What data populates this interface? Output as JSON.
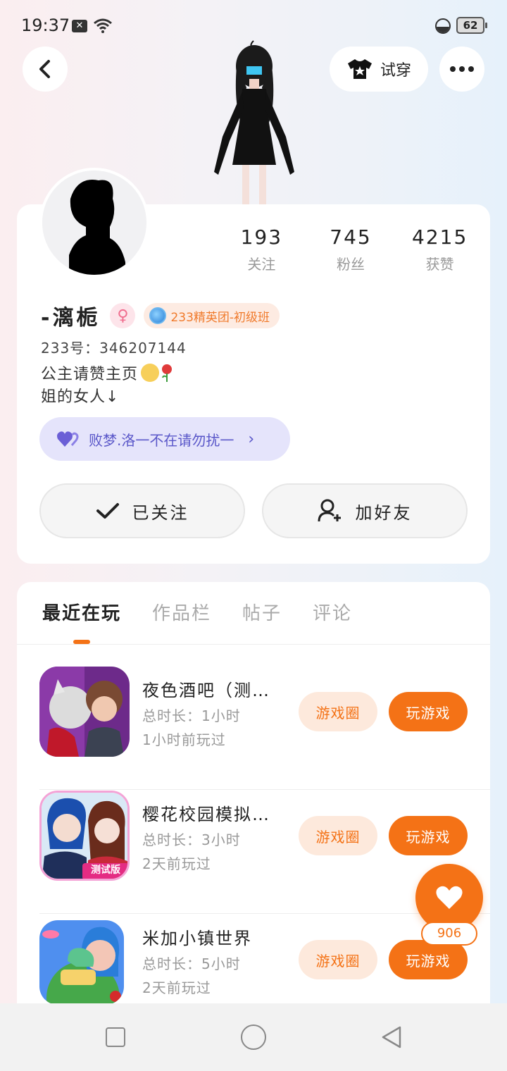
{
  "status_bar": {
    "time": "19:37",
    "battery": "62",
    "icons": [
      "notification-x-icon",
      "wifi-icon",
      "moon-icon",
      "battery-icon"
    ]
  },
  "header": {
    "tryon_label": "试穿",
    "icons": [
      "back-icon",
      "tshirt-icon",
      "more-icon"
    ]
  },
  "profile": {
    "stats": [
      {
        "value": "193",
        "label": "关注"
      },
      {
        "value": "745",
        "label": "粉丝"
      },
      {
        "value": "4215",
        "label": "获赞"
      }
    ],
    "name": "-漓栀",
    "gender_symbol": "♀",
    "tag": "233精英团-初级班",
    "uid": "233号：346207144",
    "bio": [
      "公主请赞主页",
      "姐的女人↓"
    ],
    "friend_pill": "败梦.洛一不在请勿扰一",
    "follow_label": "已关注",
    "add_friend_label": "加好友"
  },
  "tabs": [
    {
      "label": "最近在玩",
      "active": true
    },
    {
      "label": "作品栏",
      "active": false
    },
    {
      "label": "帖子",
      "active": false
    },
    {
      "label": "评论",
      "active": false
    }
  ],
  "games": [
    {
      "title": "夜色酒吧（测…",
      "duration": "总时长：1小时",
      "last_played": "1小时前玩过",
      "circle_label": "游戏圈",
      "play_label": "玩游戏"
    },
    {
      "title": "樱花校园模拟…",
      "duration": "总时长：3小时",
      "last_played": "2天前玩过",
      "circle_label": "游戏圈",
      "play_label": "玩游戏",
      "icon_badge": "测试版"
    },
    {
      "title": "米加小镇世界",
      "duration": "总时长：5小时",
      "last_played": "2天前玩过",
      "circle_label": "游戏圈",
      "play_label": "玩游戏"
    }
  ],
  "like": {
    "count": "906"
  },
  "colors": {
    "accent": "#f47216",
    "accent_light": "#fde9dc",
    "pill_bg": "#e5e4fb",
    "pill_text": "#5a57c9",
    "gender": "#f06d8e"
  }
}
